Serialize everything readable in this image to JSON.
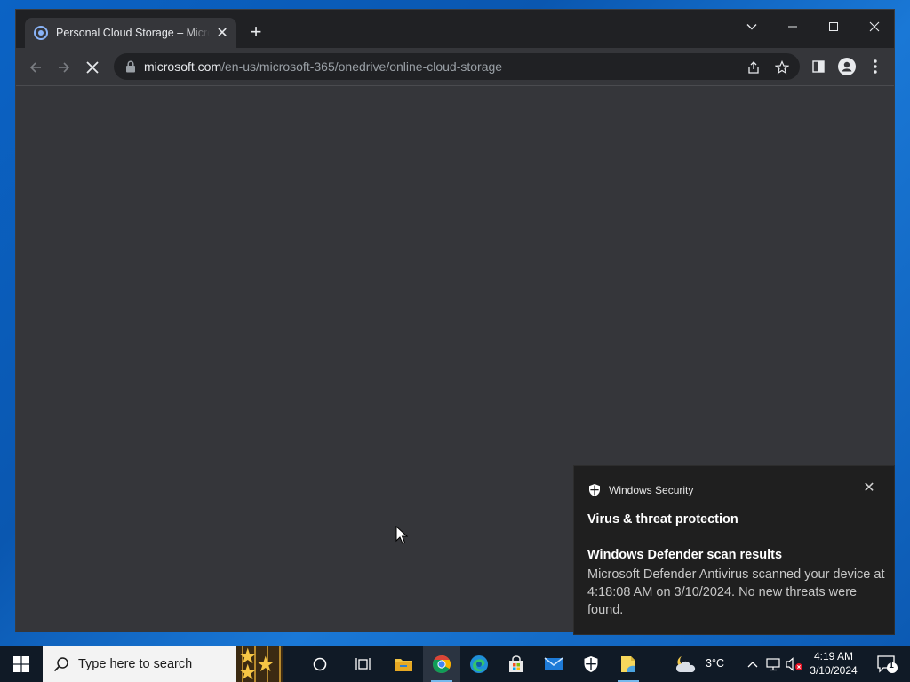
{
  "browser": {
    "tab_title": "Personal Cloud Storage – Microsoft",
    "tab_close_glyph": "✕",
    "new_tab_glyph": "+",
    "url_host": "microsoft.com",
    "url_path": "/en-us/microsoft-365/onedrive/online-cloud-storage",
    "loading": true
  },
  "notification": {
    "app_name": "Windows Security",
    "title": "Virus & threat protection",
    "subtitle": "Windows Defender scan results",
    "body": "Microsoft Defender Antivirus scanned your device at 4:18:08 AM on 3/10/2024. No new threats were found.",
    "close_glyph": "✕"
  },
  "taskbar": {
    "search_placeholder": "Type here to search",
    "weather_temp": "3°C",
    "time": "4:19 AM",
    "date": "3/10/2024",
    "notification_count": "1",
    "apps": [
      "cortana-icon",
      "task-view-icon",
      "file-explorer-icon",
      "chrome-icon",
      "edge-icon",
      "store-icon",
      "mail-icon",
      "windows-security-icon",
      "sticky-app-icon"
    ]
  },
  "colors": {
    "desktop": "#0a5fb8",
    "browser_frame": "#202124",
    "toolbar": "#35363a",
    "taskbar": "#101a26"
  }
}
